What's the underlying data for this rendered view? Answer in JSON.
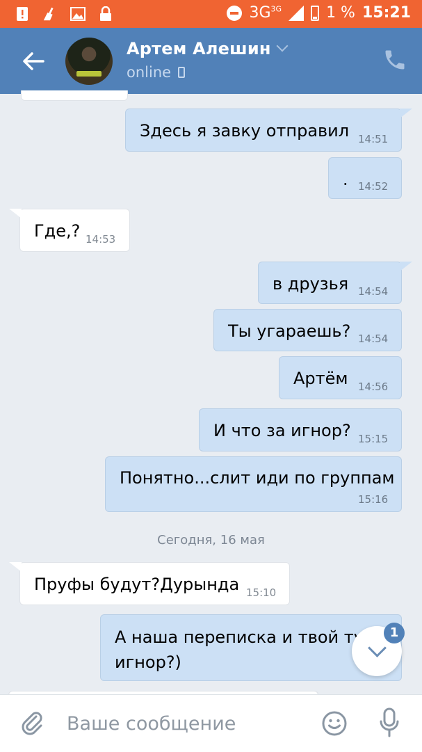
{
  "status_bar": {
    "network": "3G",
    "network_sup": "3G",
    "battery_percent": "1 %",
    "time": "15:21"
  },
  "header": {
    "contact_name": "Артем Алешин",
    "status": "online",
    "icons": {
      "back": "arrow-left-icon",
      "call": "phone-icon",
      "device": "mobile-icon"
    }
  },
  "messages": [
    {
      "dir": "out",
      "text": "Здесь я завку отправил",
      "time": "14:51"
    },
    {
      "dir": "out",
      "text": ".",
      "time": "14:52"
    },
    {
      "dir": "in",
      "text": "Где,?",
      "time": "14:53"
    },
    {
      "dir": "out",
      "text": "в друзья",
      "time": "14:54"
    },
    {
      "dir": "out",
      "text": "Ты угараешь?",
      "time": "14:54"
    },
    {
      "dir": "out",
      "text": "Артём",
      "time": "14:56"
    },
    {
      "dir": "out",
      "text": "И что за игнор?",
      "time": "15:15"
    },
    {
      "dir": "out",
      "text": "Понятно...слит иди по группам",
      "time": "15:16"
    },
    {
      "dir": "in",
      "text": "Пруфы будут?Дурында",
      "time": "15:10"
    },
    {
      "dir": "out",
      "text_line1": "А наша переписка и твой ту",
      "text_line2": "игнор?)"
    }
  ],
  "date_separator": "Сегодня, 16 мая",
  "scroll_down": {
    "unread_count": "1"
  },
  "composer": {
    "placeholder": "Ваше сообщение"
  },
  "colors": {
    "status_bar": "#f06432",
    "header": "#5181b8",
    "outgoing": "#cce0f5",
    "incoming": "#ffffff",
    "background": "#e9edf2"
  }
}
